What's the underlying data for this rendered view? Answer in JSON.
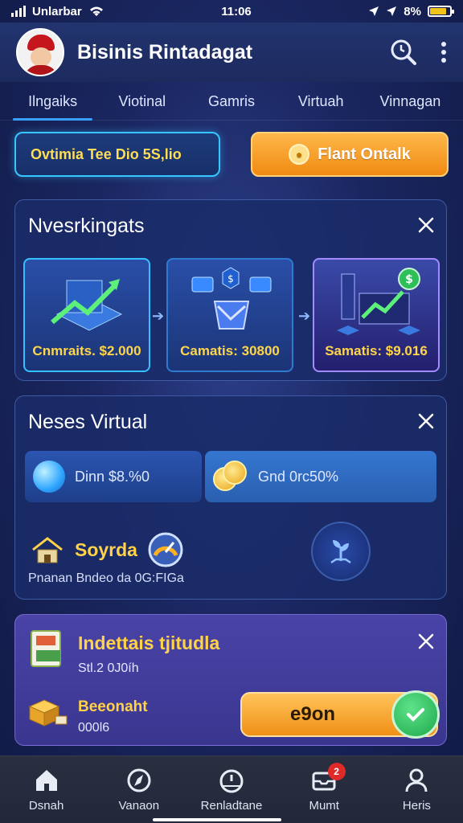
{
  "status_bar": {
    "carrier": "Unlarbar",
    "time": "11:06",
    "battery": "8%",
    "battery_level": 0.85
  },
  "header": {
    "title": "Bisinis Rintadagat"
  },
  "tabs": [
    {
      "label": "Ilngaiks",
      "active": true
    },
    {
      "label": "Viotinal",
      "active": false
    },
    {
      "label": "Gamris",
      "active": false
    },
    {
      "label": "Virtuah",
      "active": false
    },
    {
      "label": "Vinnagan",
      "active": false
    }
  ],
  "balance": {
    "text": "Ovtimia Tee Dio 5S,lio"
  },
  "action_button": {
    "label": "Flant Ontalk"
  },
  "investments": {
    "title": "Nvesrkingats",
    "tiles": [
      {
        "label": "Cnmraits. $2.000"
      },
      {
        "label": "Camatis: 30800"
      },
      {
        "label": "Samatis: $9.016"
      }
    ]
  },
  "virtual": {
    "title": "Neses Virtual",
    "pill_left": "Dinn $8.%0",
    "pill_right": "Gnd 0rc50%",
    "soynda": "Soyrda",
    "note": "Pnanan Bndeo da 0G:FIGa"
  },
  "promo": {
    "title": "Indettais tjitudla",
    "subtitle": "Stl.2 0J0íh",
    "label": "Beeonaht",
    "value": "000l6",
    "button": "e9on"
  },
  "bottom_nav": [
    {
      "label": "Dsnah",
      "icon": "home-icon"
    },
    {
      "label": "Vanaon",
      "icon": "compass-icon"
    },
    {
      "label": "Renladtane",
      "icon": "timer-icon"
    },
    {
      "label": "Mumt",
      "icon": "inbox-icon",
      "badge": "2"
    },
    {
      "label": "Heris",
      "icon": "user-icon"
    }
  ],
  "colors": {
    "accent": "#36c7ff",
    "gold": "#ffd24a",
    "orange": "#f08a12",
    "green": "#1ca84a"
  }
}
